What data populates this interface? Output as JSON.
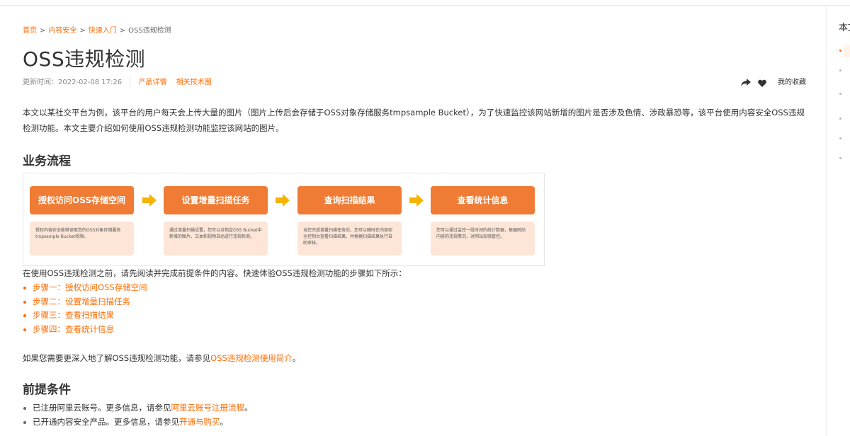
{
  "breadcrumb": {
    "items": [
      "首页",
      "内容安全",
      "快速入门"
    ],
    "current": "OSS违规检测",
    "separator": ">"
  },
  "title": "OSS违规检测",
  "meta": {
    "updated_label": "更新时间：2022-02-08 17:26",
    "tags": [
      "产品详情",
      "相关技术圈"
    ],
    "favorite_label": "我的收藏"
  },
  "intro": "本文以某社交平台为例，该平台的用户每天会上传大量的图片（图片上传后会存储于OSS对象存储服务tmpsample Bucket），为了快速监控该网站新增的图片是否涉及色情、涉政暴恐等，该平台使用内容安全OSS违规检测功能。本文主要介绍如何使用OSS违规检测功能监控该网站的图片。",
  "section_flow": {
    "heading": "业务流程",
    "steps": [
      {
        "title": "授权访问OSS存储空间",
        "desc": "授权内容安全能够读取您的OSS对象存储服务tmpsample Bucket权限。"
      },
      {
        "title": "设置增量扫描任务",
        "desc": "通过增量扫描设置，您可以对指定OSS Bucket中新增的图片、文本和视频自动进行违规检测。"
      },
      {
        "title": "查询扫描结果",
        "desc": "当您完成增量扫描任务后，您可以随时在内容安全控制台查看扫描结果，并根据扫描结果执行自助审核。"
      },
      {
        "title": "查看统计信息",
        "desc": "您可以通过监控一段时间的统计数据，根据网站内容的违规情况，对网站加强管控。"
      }
    ],
    "after_text": "在使用OSS违规检测之前，请先阅读并完成前提条件的内容。快速体验OSS违规检测功能的步骤如下所示：",
    "step_links": [
      "步骤一：授权访问OSS存储空间",
      "步骤二：设置增量扫描任务",
      "步骤三：查看扫描结果",
      "步骤四：查看统计信息"
    ],
    "more_prefix": "如果您需要更深入地了解OSS违规检测功能，请参见",
    "more_link": "OSS违规检测使用简介",
    "more_suffix": "。"
  },
  "section_pre": {
    "heading": "前提条件",
    "items": [
      {
        "prefix": "已注册阿里云账号。更多信息，请参见",
        "link": "阿里云账号注册流程",
        "suffix": "。"
      },
      {
        "prefix": "已开通内容安全产品。更多信息，请参见",
        "link": "开通与购买",
        "suffix": "。"
      }
    ]
  },
  "toc": {
    "title": "本文导读"
  },
  "colors": {
    "accent": "#ff6a00",
    "flow_head": "#ef7b34",
    "flow_body": "#fde6d8",
    "flow_arrow": "#f5b400"
  }
}
